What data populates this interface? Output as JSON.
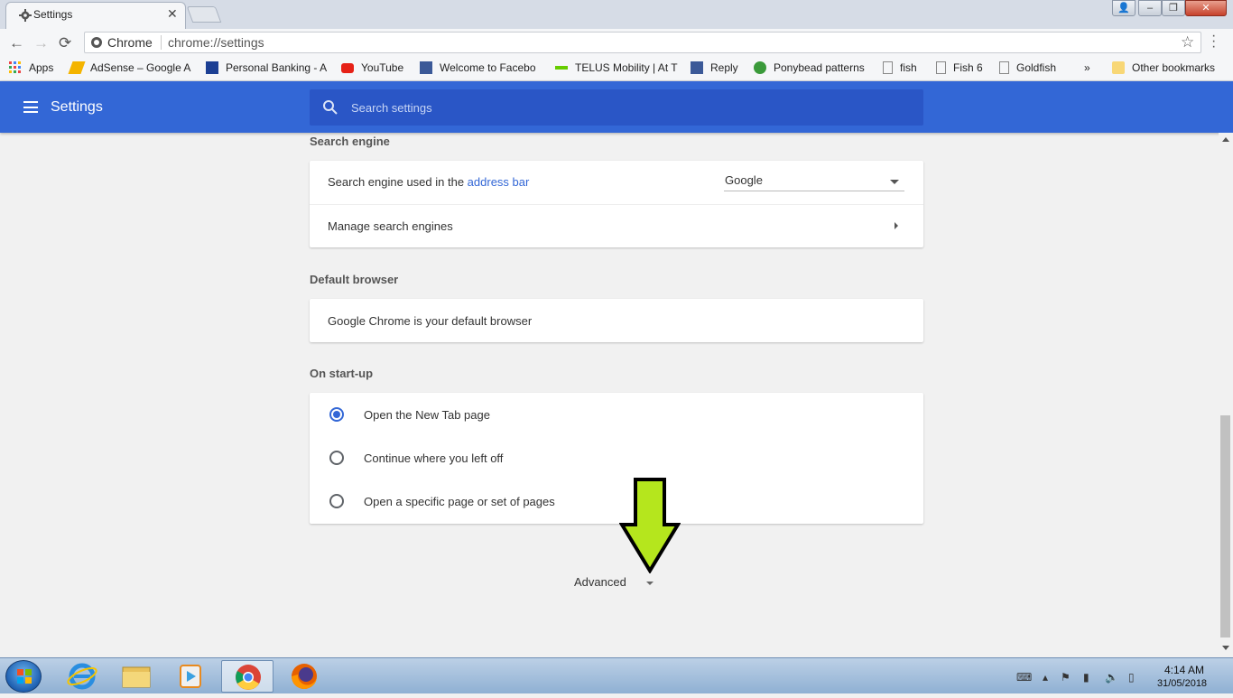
{
  "tab": {
    "title": "Settings",
    "close": "✕"
  },
  "window": {
    "minimize": "–",
    "maximize": "❐",
    "close": "✕",
    "user": "👤"
  },
  "omnibox": {
    "chip": "Chrome",
    "url": "chrome://settings",
    "star": "☆"
  },
  "nav": {
    "back": "←",
    "forward": "→",
    "reload": "⟳"
  },
  "bookmarks": [
    {
      "label": "Apps",
      "color": "#e44"
    },
    {
      "label": "AdSense – Google A",
      "color": "#f4b400"
    },
    {
      "label": "Personal Banking - A",
      "color": "#1c3f94"
    },
    {
      "label": "YouTube",
      "color": "#e62117"
    },
    {
      "label": "Welcome to Facebo",
      "color": "#3b5998"
    },
    {
      "label": "TELUS Mobility | At T",
      "color": "#66cc00"
    },
    {
      "label": "Reply",
      "color": "#3b5998"
    },
    {
      "label": "Ponybead patterns",
      "color": "#3a9a3a"
    },
    {
      "label": "fish",
      "color": "#888"
    },
    {
      "label": "Fish 6",
      "color": "#888"
    },
    {
      "label": "Goldfish",
      "color": "#888"
    },
    {
      "label": "»",
      "color": "#f5f6f8"
    },
    {
      "label": "Other bookmarks",
      "color": "#f8d776"
    }
  ],
  "header": {
    "title": "Settings",
    "search_placeholder": "Search settings"
  },
  "search_engine": {
    "section": "Search engine",
    "used_prefix": "Search engine used in the ",
    "used_link": "address bar",
    "selected": "Google",
    "manage": "Manage search engines"
  },
  "default_browser": {
    "section": "Default browser",
    "status": "Google Chrome is your default browser"
  },
  "startup": {
    "section": "On start-up",
    "options": [
      {
        "label": "Open the New Tab page",
        "selected": true
      },
      {
        "label": "Continue where you left off",
        "selected": false
      },
      {
        "label": "Open a specific page or set of pages",
        "selected": false
      }
    ]
  },
  "advanced": {
    "label": "Advanced"
  },
  "clock": {
    "time": "4:14 AM",
    "date": "31/05/2018"
  },
  "colors": {
    "accent": "#3367d6",
    "arrow": "#b5e61d"
  }
}
